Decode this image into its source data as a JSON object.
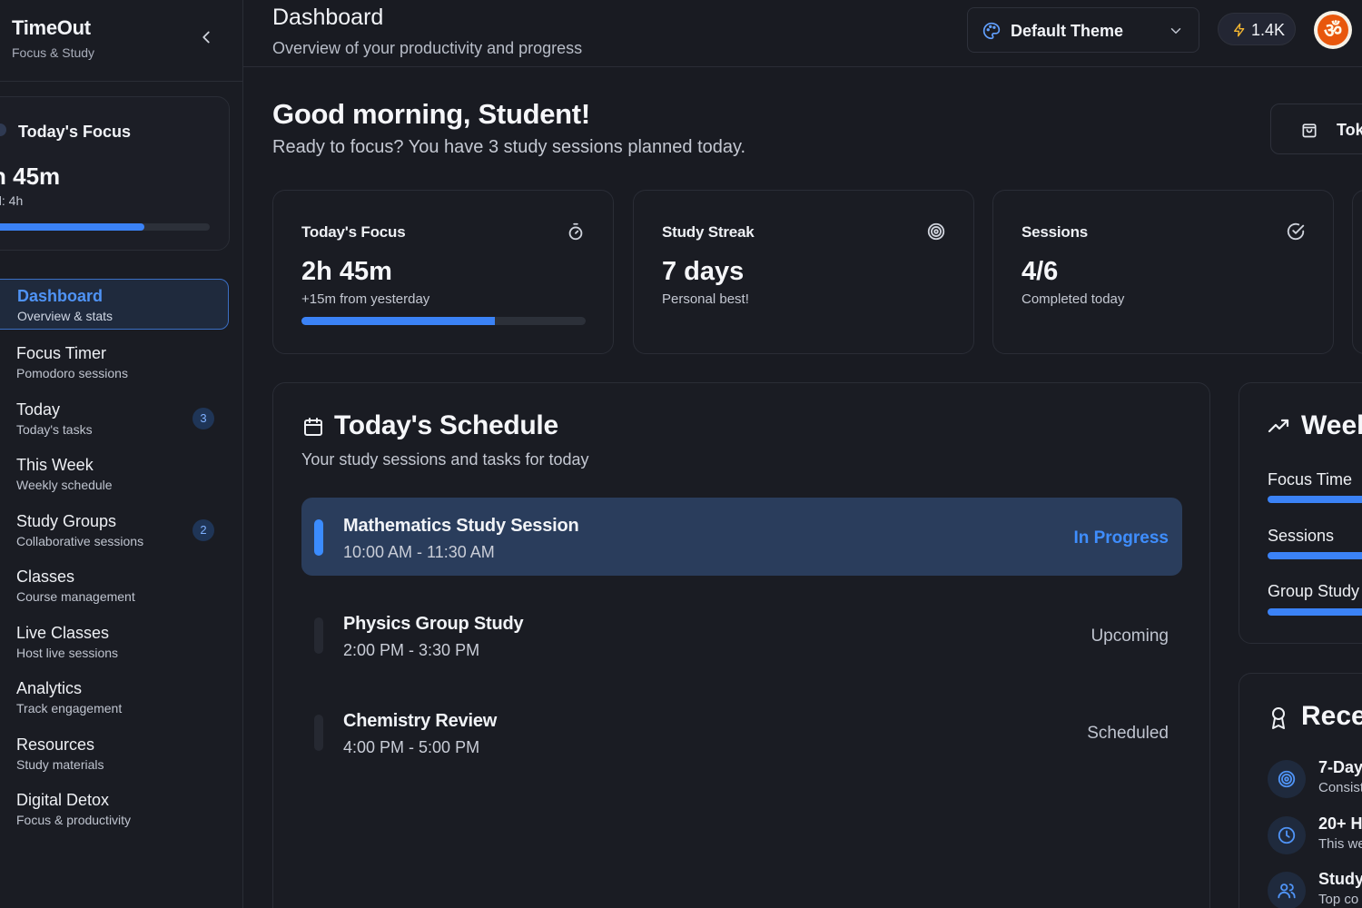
{
  "brand": {
    "title": "TimeOut",
    "subtitle": "Focus & Study"
  },
  "focus_card": {
    "title": "Today's Focus",
    "time": "h 45m",
    "goal": "al: 4h",
    "progress": 0.7
  },
  "nav": [
    {
      "label": "Dashboard",
      "sub": "Overview & stats",
      "active": true
    },
    {
      "label": "Focus Timer",
      "sub": "Pomodoro sessions"
    },
    {
      "label": "Today",
      "sub": "Today's tasks",
      "badge": "3"
    },
    {
      "label": "This Week",
      "sub": "Weekly schedule"
    },
    {
      "label": "Study Groups",
      "sub": "Collaborative sessions",
      "badge": "2"
    },
    {
      "label": "Classes",
      "sub": "Course management"
    },
    {
      "label": "Live Classes",
      "sub": "Host live sessions"
    },
    {
      "label": "Analytics",
      "sub": "Track engagement"
    },
    {
      "label": "Resources",
      "sub": "Study materials"
    },
    {
      "label": "Digital Detox",
      "sub": "Focus & productivity"
    }
  ],
  "header": {
    "title": "Dashboard",
    "subtitle": "Overview of your productivity and progress",
    "theme_label": "Default Theme",
    "points": "1.4K",
    "avatar_glyph": "ॐ"
  },
  "greeting": {
    "title": "Good morning, Student!",
    "subtitle": "Ready to focus? You have 3 study sessions planned today.",
    "button_label": "Tok"
  },
  "stats": [
    {
      "title": "Today's Focus",
      "value": "2h 45m",
      "sub": "+15m from yesterday",
      "progress": 0.68,
      "icon": "stopwatch-icon"
    },
    {
      "title": "Study Streak",
      "value": "7 days",
      "sub": "Personal best!",
      "icon": "target-icon"
    },
    {
      "title": "Sessions",
      "value": "4/6",
      "sub": "Completed today",
      "icon": "check-circle-icon"
    }
  ],
  "schedule": {
    "title": "Today's Schedule",
    "subtitle": "Your study sessions and tasks for today",
    "sessions": [
      {
        "name": "Mathematics Study Session",
        "time": "10:00 AM - 11:30 AM",
        "status": "In Progress",
        "active": true
      },
      {
        "name": "Physics Group Study",
        "time": "2:00 PM - 3:30 PM",
        "status": "Upcoming"
      },
      {
        "name": "Chemistry Review",
        "time": "4:00 PM - 5:00 PM",
        "status": "Scheduled"
      }
    ]
  },
  "weekly": {
    "title": "Week",
    "rows": [
      "Focus Time",
      "Sessions",
      "Group Study"
    ]
  },
  "recent": {
    "title": "Recen",
    "items": [
      {
        "title": "7-Day",
        "sub": "Consist",
        "icon": "target-icon"
      },
      {
        "title": "20+ H",
        "sub": "This we",
        "icon": "clock-icon"
      },
      {
        "title": "Study",
        "sub": "Top co",
        "icon": "users-icon"
      }
    ]
  },
  "colors": {
    "accent": "#3b82f6",
    "active_bg": "#2a3d5c",
    "bolt": "#f5b731"
  }
}
